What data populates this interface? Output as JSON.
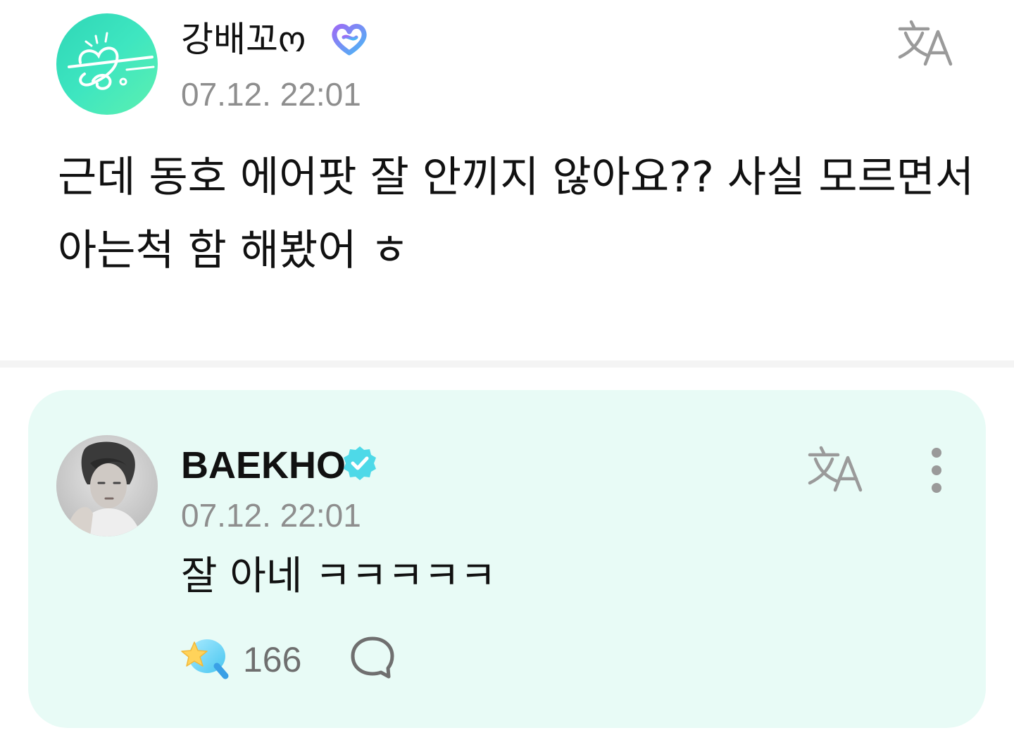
{
  "post": {
    "author": "강배꼬ო",
    "timestamp": "07.12. 22:01",
    "body_line1": "근데 동호 에어팟 잘 안끼지 않아요?? 사실 모르면서",
    "body_line2": "아는척 함 해봤어 ㅎ",
    "translate_icon": "translate-icon",
    "membership_badge_icon": "heart-badge-icon"
  },
  "reply": {
    "author": "BAEKHO",
    "verified_icon": "verified-badge-icon",
    "timestamp": "07.12. 22:01",
    "body": "잘 아네 ㅋㅋㅋㅋㅋ",
    "like_count": "166",
    "like_icon": "star-lightstick-icon",
    "comment_icon": "comment-icon",
    "more_icon": "more-vertical-icon",
    "translate_icon": "translate-icon"
  },
  "colors": {
    "reply_background": "#e8fbf6",
    "accent_mint": "#3ee6c0",
    "timestamp_gray": "#8e8e8e",
    "verified_cyan": "#4ed9e8"
  }
}
